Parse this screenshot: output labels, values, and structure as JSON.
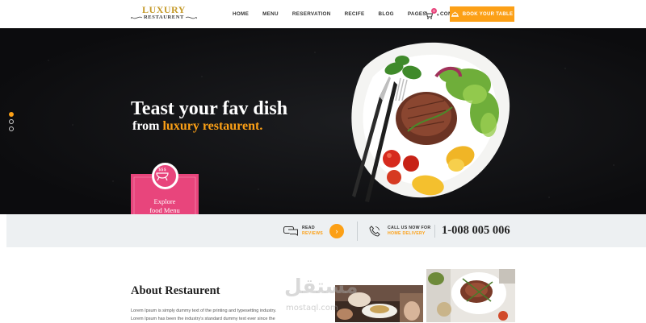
{
  "brand": {
    "name": "LUXURY",
    "tagline": "RESTAURENT"
  },
  "nav": {
    "items": [
      "HOME",
      "MENU",
      "RESERVATION",
      "RECIFE",
      "BLOG",
      "PAGES",
      "CONTACT"
    ]
  },
  "cart": {
    "count": "0",
    "icon": "cart-icon"
  },
  "cta": {
    "book_label": "BOOK YOUR TABLE",
    "icon": "cloche-icon"
  },
  "hero": {
    "headline": "Teast your fav dish",
    "sub_prefix": "from ",
    "sub_accent": "luxury restaurent.",
    "slides": 3,
    "active_slide": 0
  },
  "ribbon": {
    "icon_text": "$$$",
    "line1": "Explore",
    "line2": "food Menu"
  },
  "infobar": {
    "reviews_line1": "READ",
    "reviews_line2": "REVIEWS",
    "reviews_arrow": "›",
    "call_line1": "CALL US NOW FOR",
    "call_line2": "HOME DELIVERY",
    "phone": "1-008 005 006"
  },
  "about": {
    "title": "About Restaurent",
    "lines": [
      "Lorem Ipsum is simply dummy text of the printing and typesetting industry.",
      "Lorem Ipsum has been the industry's standard dummy text ever since the"
    ]
  },
  "watermark": {
    "arabic": "مستقل",
    "latin": "mostaql.com"
  },
  "colors": {
    "accent": "#fca016",
    "pink": "#e8457c",
    "hero_bg": "#111214",
    "infobar_bg": "#edf0f2"
  }
}
